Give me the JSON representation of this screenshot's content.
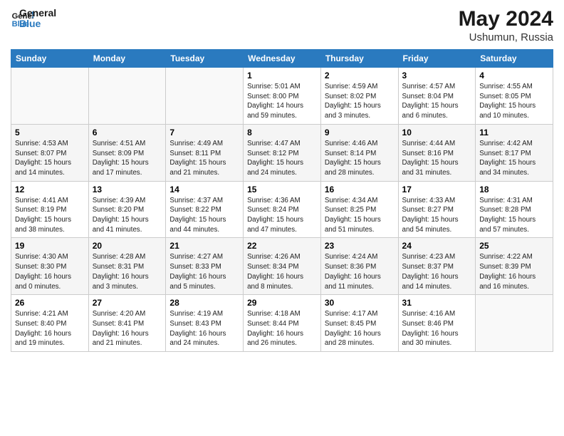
{
  "logo": {
    "line1": "General",
    "line2": "Blue"
  },
  "title": "May 2024",
  "subtitle": "Ushumun, Russia",
  "days_of_week": [
    "Sunday",
    "Monday",
    "Tuesday",
    "Wednesday",
    "Thursday",
    "Friday",
    "Saturday"
  ],
  "weeks": [
    [
      {
        "day": "",
        "info": ""
      },
      {
        "day": "",
        "info": ""
      },
      {
        "day": "",
        "info": ""
      },
      {
        "day": "1",
        "info": "Sunrise: 5:01 AM\nSunset: 8:00 PM\nDaylight: 14 hours and 59 minutes."
      },
      {
        "day": "2",
        "info": "Sunrise: 4:59 AM\nSunset: 8:02 PM\nDaylight: 15 hours and 3 minutes."
      },
      {
        "day": "3",
        "info": "Sunrise: 4:57 AM\nSunset: 8:04 PM\nDaylight: 15 hours and 6 minutes."
      },
      {
        "day": "4",
        "info": "Sunrise: 4:55 AM\nSunset: 8:05 PM\nDaylight: 15 hours and 10 minutes."
      }
    ],
    [
      {
        "day": "5",
        "info": "Sunrise: 4:53 AM\nSunset: 8:07 PM\nDaylight: 15 hours and 14 minutes."
      },
      {
        "day": "6",
        "info": "Sunrise: 4:51 AM\nSunset: 8:09 PM\nDaylight: 15 hours and 17 minutes."
      },
      {
        "day": "7",
        "info": "Sunrise: 4:49 AM\nSunset: 8:11 PM\nDaylight: 15 hours and 21 minutes."
      },
      {
        "day": "8",
        "info": "Sunrise: 4:47 AM\nSunset: 8:12 PM\nDaylight: 15 hours and 24 minutes."
      },
      {
        "day": "9",
        "info": "Sunrise: 4:46 AM\nSunset: 8:14 PM\nDaylight: 15 hours and 28 minutes."
      },
      {
        "day": "10",
        "info": "Sunrise: 4:44 AM\nSunset: 8:16 PM\nDaylight: 15 hours and 31 minutes."
      },
      {
        "day": "11",
        "info": "Sunrise: 4:42 AM\nSunset: 8:17 PM\nDaylight: 15 hours and 34 minutes."
      }
    ],
    [
      {
        "day": "12",
        "info": "Sunrise: 4:41 AM\nSunset: 8:19 PM\nDaylight: 15 hours and 38 minutes."
      },
      {
        "day": "13",
        "info": "Sunrise: 4:39 AM\nSunset: 8:20 PM\nDaylight: 15 hours and 41 minutes."
      },
      {
        "day": "14",
        "info": "Sunrise: 4:37 AM\nSunset: 8:22 PM\nDaylight: 15 hours and 44 minutes."
      },
      {
        "day": "15",
        "info": "Sunrise: 4:36 AM\nSunset: 8:24 PM\nDaylight: 15 hours and 47 minutes."
      },
      {
        "day": "16",
        "info": "Sunrise: 4:34 AM\nSunset: 8:25 PM\nDaylight: 15 hours and 51 minutes."
      },
      {
        "day": "17",
        "info": "Sunrise: 4:33 AM\nSunset: 8:27 PM\nDaylight: 15 hours and 54 minutes."
      },
      {
        "day": "18",
        "info": "Sunrise: 4:31 AM\nSunset: 8:28 PM\nDaylight: 15 hours and 57 minutes."
      }
    ],
    [
      {
        "day": "19",
        "info": "Sunrise: 4:30 AM\nSunset: 8:30 PM\nDaylight: 16 hours and 0 minutes."
      },
      {
        "day": "20",
        "info": "Sunrise: 4:28 AM\nSunset: 8:31 PM\nDaylight: 16 hours and 3 minutes."
      },
      {
        "day": "21",
        "info": "Sunrise: 4:27 AM\nSunset: 8:33 PM\nDaylight: 16 hours and 5 minutes."
      },
      {
        "day": "22",
        "info": "Sunrise: 4:26 AM\nSunset: 8:34 PM\nDaylight: 16 hours and 8 minutes."
      },
      {
        "day": "23",
        "info": "Sunrise: 4:24 AM\nSunset: 8:36 PM\nDaylight: 16 hours and 11 minutes."
      },
      {
        "day": "24",
        "info": "Sunrise: 4:23 AM\nSunset: 8:37 PM\nDaylight: 16 hours and 14 minutes."
      },
      {
        "day": "25",
        "info": "Sunrise: 4:22 AM\nSunset: 8:39 PM\nDaylight: 16 hours and 16 minutes."
      }
    ],
    [
      {
        "day": "26",
        "info": "Sunrise: 4:21 AM\nSunset: 8:40 PM\nDaylight: 16 hours and 19 minutes."
      },
      {
        "day": "27",
        "info": "Sunrise: 4:20 AM\nSunset: 8:41 PM\nDaylight: 16 hours and 21 minutes."
      },
      {
        "day": "28",
        "info": "Sunrise: 4:19 AM\nSunset: 8:43 PM\nDaylight: 16 hours and 24 minutes."
      },
      {
        "day": "29",
        "info": "Sunrise: 4:18 AM\nSunset: 8:44 PM\nDaylight: 16 hours and 26 minutes."
      },
      {
        "day": "30",
        "info": "Sunrise: 4:17 AM\nSunset: 8:45 PM\nDaylight: 16 hours and 28 minutes."
      },
      {
        "day": "31",
        "info": "Sunrise: 4:16 AM\nSunset: 8:46 PM\nDaylight: 16 hours and 30 minutes."
      },
      {
        "day": "",
        "info": ""
      }
    ]
  ]
}
